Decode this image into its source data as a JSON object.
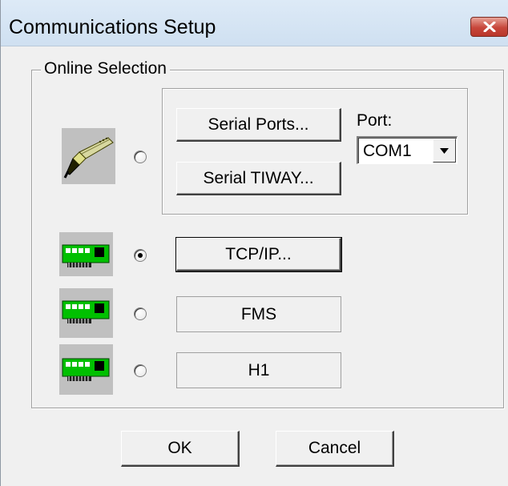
{
  "window": {
    "title": "Communications Setup",
    "close_icon": "close-icon"
  },
  "group": {
    "label": "Online Selection"
  },
  "serial": {
    "serial_ports_label": "Serial Ports...",
    "serial_tiway_label": "Serial TIWAY...",
    "port_label": "Port:",
    "port_value": "COM1",
    "selected": false,
    "icon": "serial-cable-icon"
  },
  "tcpip": {
    "label": "TCP/IP...",
    "selected": true,
    "icon": "network-card-icon"
  },
  "fms": {
    "label": "FMS",
    "selected": false,
    "icon": "network-card-icon"
  },
  "h1": {
    "label": "H1",
    "selected": false,
    "icon": "network-card-icon"
  },
  "footer": {
    "ok_label": "OK",
    "cancel_label": "Cancel"
  },
  "colors": {
    "close_button": "#c7463a",
    "titlebar": "#d5e5f5",
    "face": "#f0f0f0"
  }
}
